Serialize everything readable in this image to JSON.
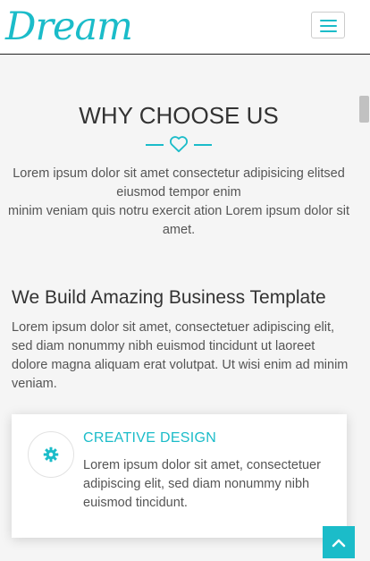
{
  "brand": {
    "logo_text": "Dream",
    "accent_color": "#1bbcc9"
  },
  "nav": {
    "toggle_icon": "hamburger-menu-icon"
  },
  "why": {
    "title": "WHY CHOOSE US",
    "divider_icon": "heart-icon",
    "intro_line1": "Lorem ipsum dolor sit amet consectetur adipisicing elitsed eiusmod tempor enim",
    "intro_line2": "minim veniam quis notru exercit ation Lorem ipsum dolor sit amet."
  },
  "build": {
    "title": "We Build Amazing Business Template",
    "text": "Lorem ipsum dolor sit amet, consectetuer adipiscing elit, sed diam nonummy nibh euismod tincidunt ut laoreet dolore magna aliquam erat volutpat. Ut wisi enim ad minim veniam."
  },
  "feature": {
    "icon": "gear-icon",
    "title": "CREATIVE DESIGN",
    "text": "Lorem ipsum dolor sit amet, consectetuer adipiscing elit, sed diam nonummy nibh euismod tincidunt."
  },
  "back_to_top": {
    "icon": "chevron-up-icon"
  }
}
